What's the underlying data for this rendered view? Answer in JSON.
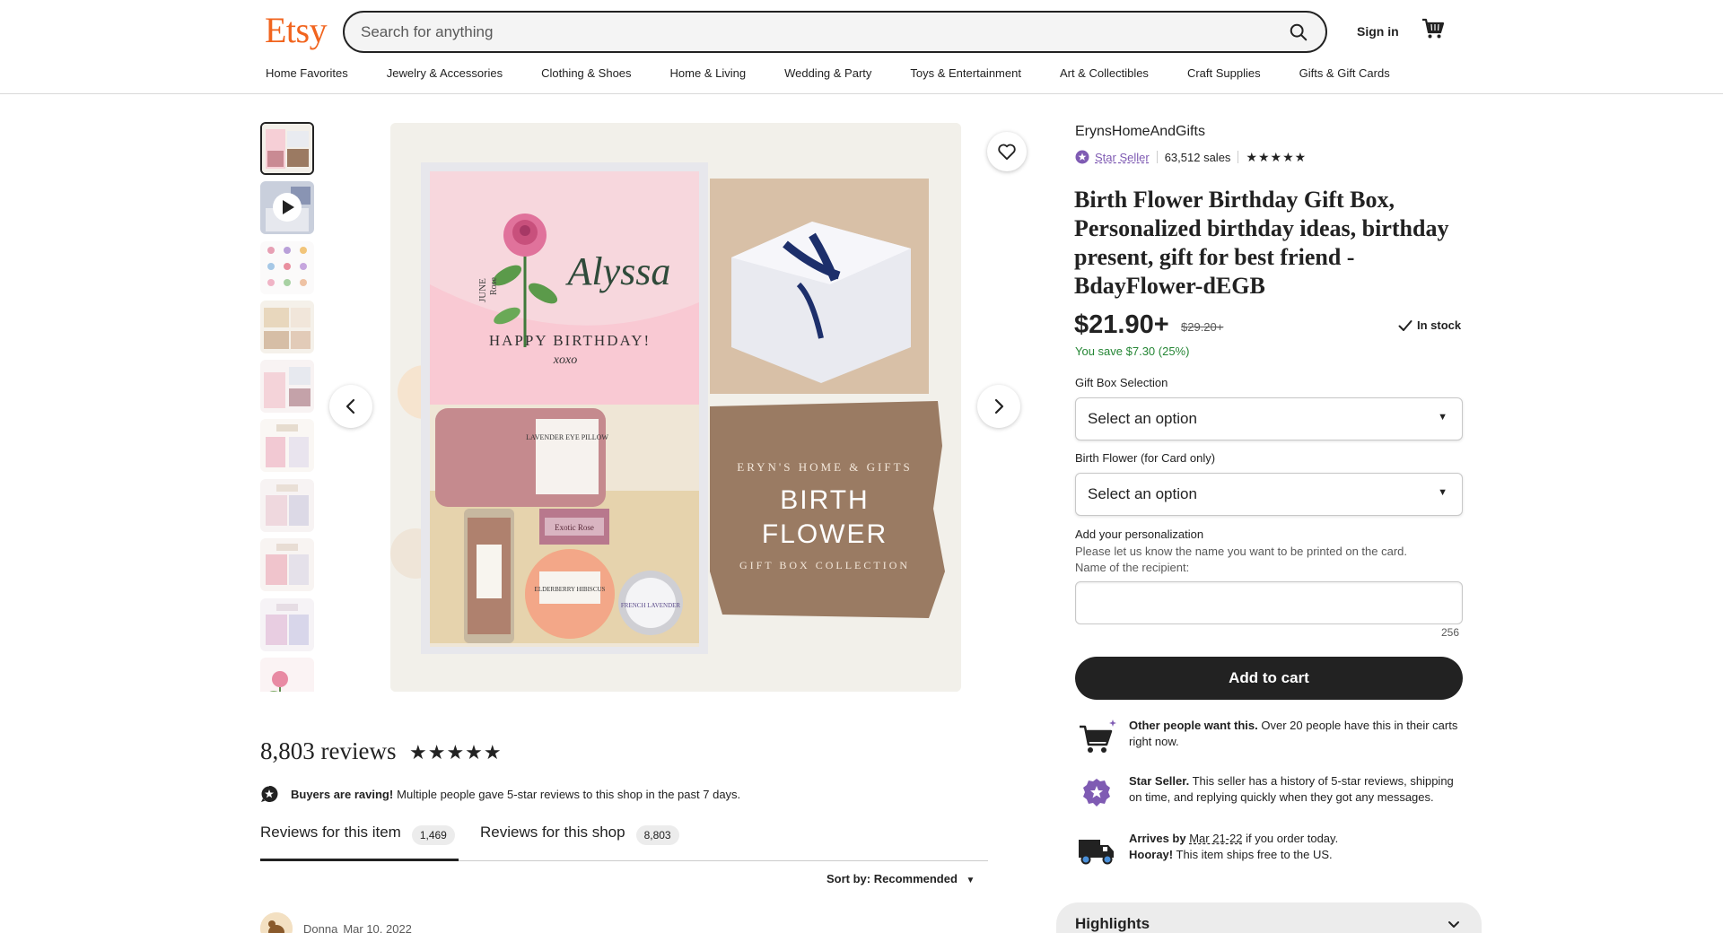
{
  "header": {
    "logo": "Etsy",
    "search_placeholder": "Search for anything",
    "sign_in": "Sign in"
  },
  "categories": [
    "Home Favorites",
    "Jewelry & Accessories",
    "Clothing & Shoes",
    "Home & Living",
    "Wedding & Party",
    "Toys & Entertainment",
    "Art & Collectibles",
    "Craft Supplies",
    "Gifts & Gift Cards"
  ],
  "image": {
    "card_name": "Alyssa",
    "card_month": "JUNE",
    "card_flower": "Rose",
    "card_greeting": "HAPPY BIRTHDAY!",
    "card_sign": "xoxo",
    "pillow_label": "LAVENDER EYE PILLOW",
    "soap_label": "Exotic Rose",
    "candle_label": "ELDERBERRY HIBISCUS",
    "tin_label": "FRENCH LAVENDER",
    "brand_line": "ERYN'S HOME & GIFTS",
    "banner_line1": "BIRTH",
    "banner_line2": "FLOWER",
    "banner_sub": "GIFT BOX COLLECTION"
  },
  "listing": {
    "shop_name": "ErynsHomeAndGifts",
    "star_seller": "Star Seller",
    "sales": "63,512 sales",
    "rating_stars": "★★★★★",
    "title": "Birth Flower Birthday Gift Box, Personalized birthday ideas, birthday present, gift for best friend - BdayFlower-dEGB",
    "price": "$21.90+",
    "old_price": "$29.20+",
    "stock": "In stock",
    "savings": "You save $7.30 (25%)",
    "option1_label": "Gift Box Selection",
    "option1_value": "Select an option",
    "option2_label": "Birth Flower (for Card only)",
    "option2_value": "Select an option",
    "personalization_label": "Add your personalization",
    "personalization_help1": "Please let us know the name you want to be printed on the card.",
    "personalization_help2": "Name of the recipient:",
    "char_count": "256",
    "add_to_cart": "Add to cart"
  },
  "info": {
    "demand_bold": "Other people want this.",
    "demand_text": "Over 20 people have this in their carts right now.",
    "seller_bold": "Star Seller.",
    "seller_text": "This seller has a history of 5-star reviews, shipping on time, and replying quickly when they got any messages.",
    "arrives_prefix": "Arrives by",
    "arrives_date": "Mar 21-22",
    "arrives_suffix": "if you order today.",
    "hooray_bold": "Hooray!",
    "hooray_text": "This item ships free to the US."
  },
  "highlights": "Highlights",
  "reviews": {
    "count_title": "8,803 reviews",
    "stars": "★★★★★",
    "raving_bold": "Buyers are raving!",
    "raving_text": "Multiple people gave 5-star reviews to this shop in the past 7 days.",
    "tab1_label": "Reviews for this item",
    "tab1_count": "1,469",
    "tab2_label": "Reviews for this shop",
    "tab2_count": "8,803",
    "sort": "Sort by: Recommended",
    "first_reviewer": "Donna",
    "first_date": "Mar 10, 2022"
  },
  "colors": {
    "brand": "#f1641e",
    "star_seller": "#7f5bb3",
    "savings": "#258635",
    "button": "#222222"
  }
}
